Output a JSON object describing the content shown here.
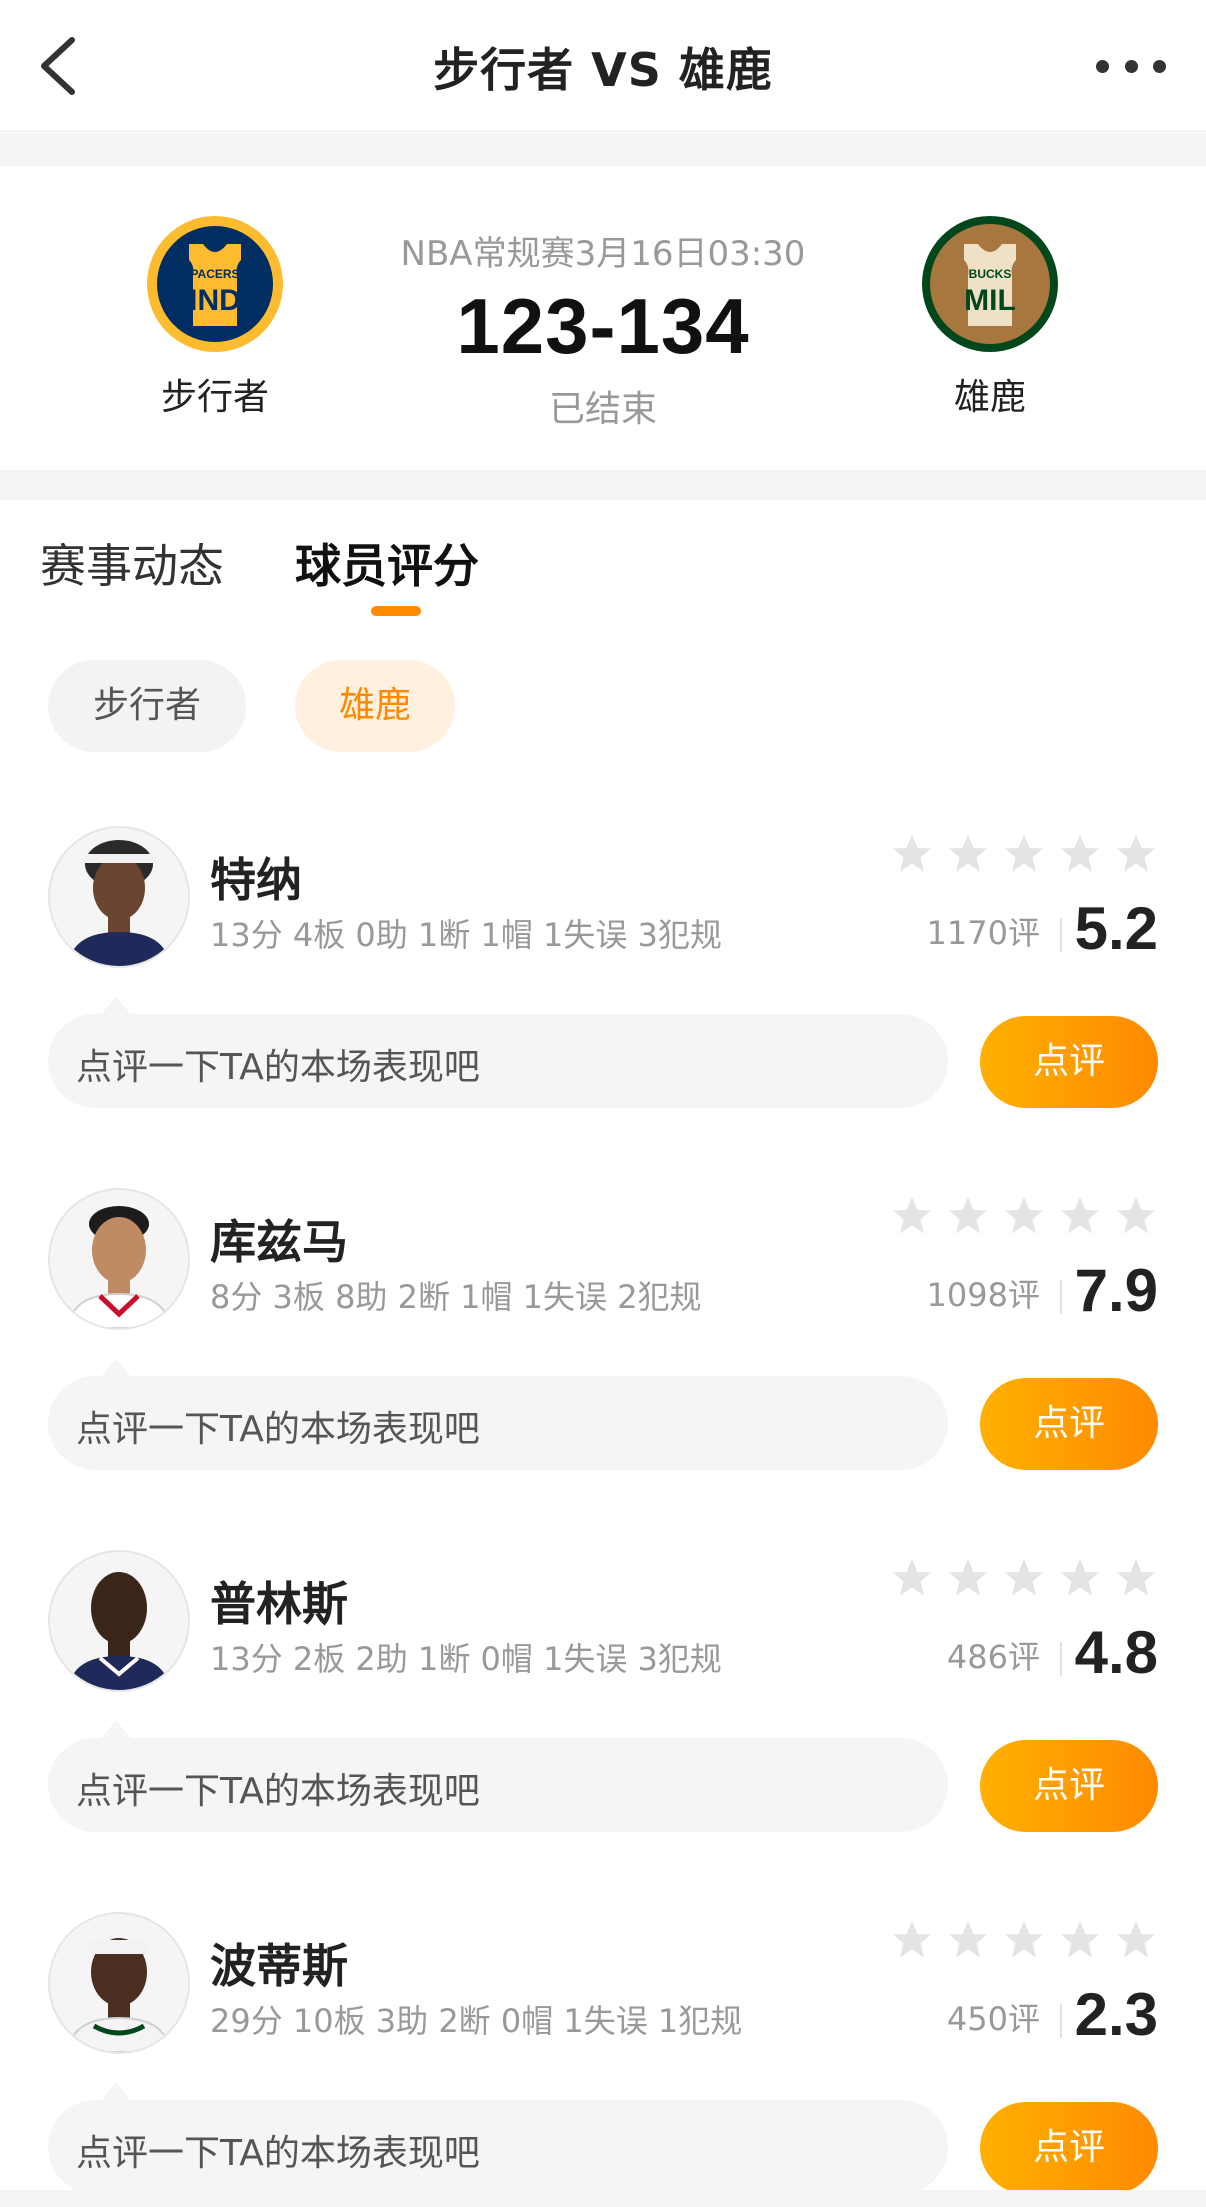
{
  "nav": {
    "title": "步行者 VS 雄鹿",
    "back_icon": "chevron-left-icon",
    "more_icon": "more-horizontal-icon"
  },
  "match": {
    "meta": "NBA常规赛3月16日03:30",
    "score": "123-134",
    "status": "已结束",
    "home": {
      "name": "步行者",
      "logo_top": "PACERS",
      "logo_abbr": "IND",
      "logo_color": "#002D62",
      "logo_accent": "#FDBB30"
    },
    "away": {
      "name": "雄鹿",
      "logo_top": "BUCKS",
      "logo_abbr": "MIL",
      "logo_color": "#00471B",
      "logo_accent": "#EEE1C6"
    }
  },
  "tabs": [
    {
      "label": "赛事动态",
      "active": false
    },
    {
      "label": "球员评分",
      "active": true
    }
  ],
  "accent_color": "#FF8A00",
  "team_filter": [
    {
      "label": "步行者",
      "active": false
    },
    {
      "label": "雄鹿",
      "active": true
    }
  ],
  "players": [
    {
      "name": "特纳",
      "stats": "13分 4板 0助 1断 1帽 1失误 3犯规",
      "rating_count": "1170评",
      "score": "5.2",
      "comment_placeholder": "点评一下TA的本场表现吧",
      "rate_label": "点评"
    },
    {
      "name": "库兹马",
      "stats": "8分 3板 8助 2断 1帽 1失误 2犯规",
      "rating_count": "1098评",
      "score": "7.9",
      "comment_placeholder": "点评一下TA的本场表现吧",
      "rate_label": "点评"
    },
    {
      "name": "普林斯",
      "stats": "13分 2板 2助 1断 0帽 1失误 3犯规",
      "rating_count": "486评",
      "score": "4.8",
      "comment_placeholder": "点评一下TA的本场表现吧",
      "rate_label": "点评"
    },
    {
      "name": "波蒂斯",
      "stats": "29分 10板 3助 2断 0帽 1失误 1犯规",
      "rating_count": "450评",
      "score": "2.3",
      "comment_placeholder": "点评一下TA的本场表现吧",
      "rate_label": "点评"
    }
  ]
}
